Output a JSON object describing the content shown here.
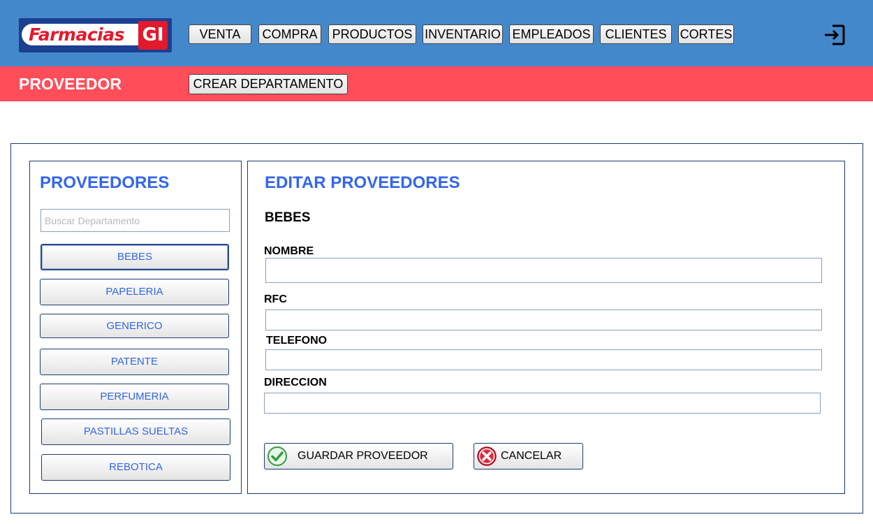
{
  "brand": {
    "logo_text": "Farmacias",
    "logo_badge": "GI"
  },
  "nav": {
    "venta": "VENTA",
    "compra": "COMPRA",
    "productos": "PRODUCTOS",
    "inventario": "INVENTARIO",
    "empleados": "EMPLEADOS",
    "clientes": "CLIENTES",
    "cortes": "CORTES",
    "logout_icon": "logout-icon"
  },
  "subheader": {
    "title": "PROVEEDOR",
    "crear_label": "CREAR DEPARTAMENTO"
  },
  "left": {
    "title": "PROVEEDORES",
    "search_placeholder": "Buscar Departamento",
    "items": [
      "BEBES",
      "PAPELERIA",
      "GENERICO",
      "PATENTE",
      "PERFUMERIA",
      "PASTILLAS SUELTAS",
      "REBOTICA"
    ],
    "selected": "BEBES"
  },
  "right": {
    "title": "EDITAR PROVEEDORES",
    "section": "BEBES",
    "fields": {
      "nombre": {
        "label": "NOMBRE",
        "value": ""
      },
      "rfc": {
        "label": "RFC",
        "value": ""
      },
      "telefono": {
        "label": "TELEFONO",
        "value": ""
      },
      "direccion": {
        "label": "DIRECCION",
        "value": ""
      }
    },
    "save_label": "GUARDAR PROVEEDOR",
    "cancel_label": "CANCELAR"
  },
  "colors": {
    "topbar": "#4488cc",
    "subbar": "#ff4d5a",
    "accent_blue": "#3366ee",
    "border": "#1c3c6c",
    "check_green": "#2e9e3c",
    "cancel_red": "#e0283a"
  }
}
